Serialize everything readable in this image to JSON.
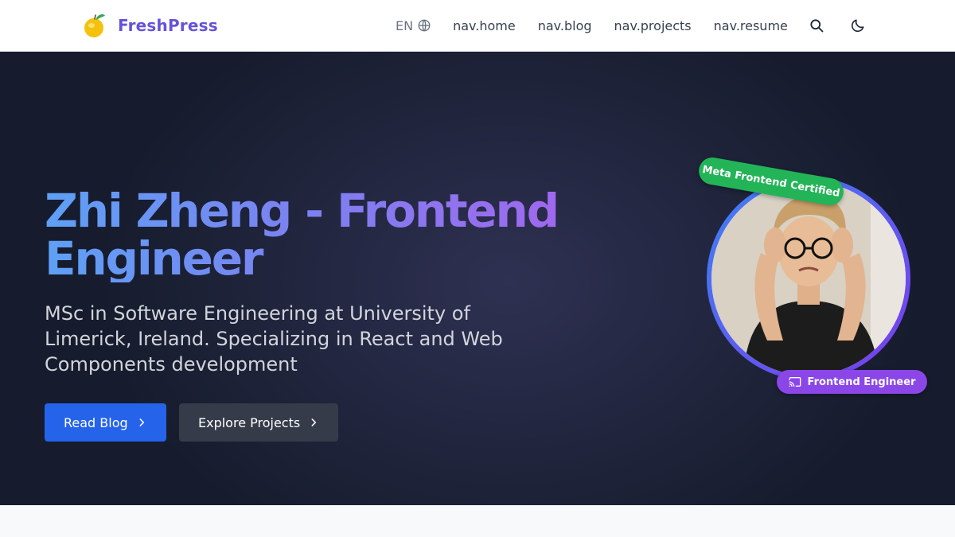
{
  "header": {
    "brand": "FreshPress",
    "language": "EN",
    "nav": [
      {
        "label": "nav.home"
      },
      {
        "label": "nav.blog"
      },
      {
        "label": "nav.projects"
      },
      {
        "label": "nav.resume"
      }
    ],
    "icons": [
      "lemon-logo-icon",
      "globe-icon",
      "search-icon",
      "moon-icon"
    ]
  },
  "hero": {
    "title": "Zhi Zheng - Frontend Engineer",
    "subtitle": "MSc in Software Engineering at University of Limerick, Ireland. Specializing in React and Web Components development",
    "primary_button": "Read Blog",
    "secondary_button": "Explore Projects",
    "badge_certified": "Meta Frontend Certified",
    "badge_role": "Frontend Engineer"
  },
  "colors": {
    "brand": "#6553d9",
    "primary_button": "#2563eb",
    "badge_certified": "#22b457",
    "badge_role": "#8b46e8"
  }
}
